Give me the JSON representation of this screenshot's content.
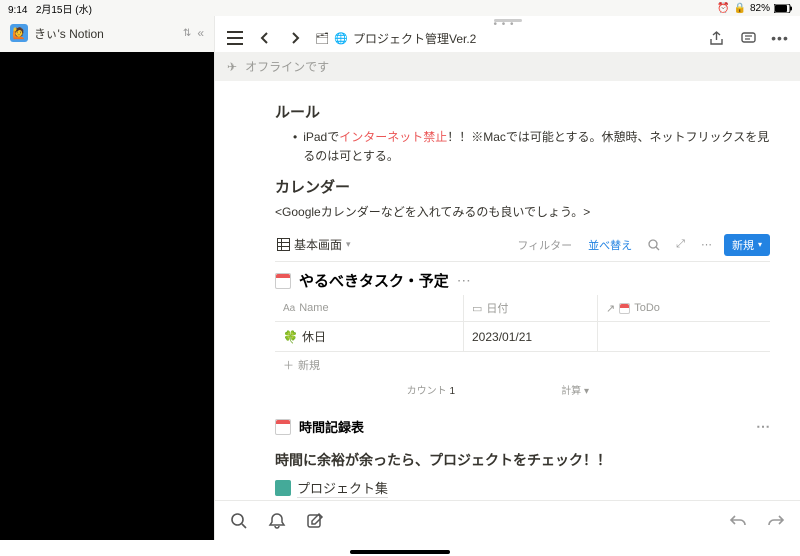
{
  "status": {
    "time": "9:14",
    "date": "2月15日 (水)",
    "battery": "82%"
  },
  "workspace": {
    "name": "きぃ's Notion",
    "avatar_emoji": "🙋"
  },
  "breadcrumb": {
    "parent_icon": "🗂",
    "child_icon": "🌐",
    "title": "プロジェクト管理Ver.2"
  },
  "offline": {
    "text": "オフラインです"
  },
  "sections": {
    "rules": {
      "heading": "ルール",
      "bullet_pre": "iPadで",
      "bullet_red": "インターネット禁止",
      "bullet_post": "！！※Macでは可能とする。休憩時、ネットフリックスを見るのは可とする。"
    },
    "calendar": {
      "heading": "カレンダー",
      "hint": "<Googleカレンダーなどを入れてみるのも良いでしょう。>"
    }
  },
  "db": {
    "tab_label": "基本画面",
    "controls": {
      "filter": "フィルター",
      "sort": "並べ替え",
      "new": "新規"
    },
    "title": "やるべきタスク・予定",
    "columns": {
      "name": "Name",
      "name_prefix": "Aa",
      "date": "日付",
      "todo": "ToDo"
    },
    "rows": [
      {
        "icon": "🍀",
        "name": "休日",
        "date": "2023/01/21",
        "todo": ""
      }
    ],
    "newrow": "新規",
    "footer": {
      "count_label": "カウント",
      "count_value": "1",
      "calc_label": "計算"
    }
  },
  "linked": {
    "title": "時間記録表"
  },
  "cta": {
    "heading": "時間に余裕が余ったら、プロジェクトをチェック！！",
    "page": "プロジェクト集"
  }
}
